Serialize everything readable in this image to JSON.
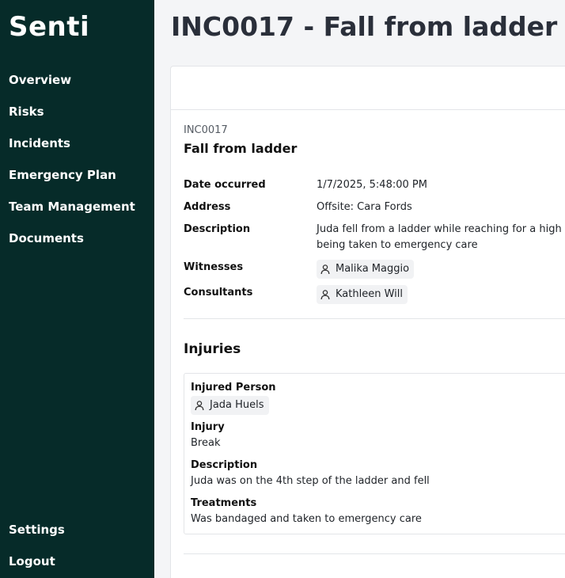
{
  "sidebar": {
    "logo": "Senti",
    "nav": [
      "Overview",
      "Risks",
      "Incidents",
      "Emergency Plan",
      "Team Management",
      "Documents"
    ],
    "bottom": [
      "Settings",
      "Logout"
    ]
  },
  "page": {
    "title": "INC0017 - Fall from ladder"
  },
  "incident": {
    "id": "INC0017",
    "title": "Fall from ladder",
    "fields": {
      "date_label": "Date occurred",
      "date_value": "1/7/2025, 5:48:00 PM",
      "address_label": "Address",
      "address_value": "Offsite: Cara Fords",
      "description_label": "Description",
      "description_value": "Juda fell from a ladder while reaching for a high sh being taken to emergency care",
      "witnesses_label": "Witnesses",
      "witness": "Malika Maggio",
      "consultants_label": "Consultants",
      "consultant": "Kathleen Will"
    }
  },
  "injuries": {
    "heading": "Injuries",
    "injured_person_label": "Injured Person",
    "injured_person": "Jada Huels",
    "injury_label": "Injury",
    "injury_value": "Break",
    "description_label": "Description",
    "description_value": "Juda was on the 4th step of the ladder and fell",
    "treatments_label": "Treatments",
    "treatments_value": "Was bandaged and taken to emergency care"
  },
  "icons": {
    "person": "person-icon"
  },
  "colors": {
    "sidebar_bg": "#062b29",
    "page_bg": "#f4f5f7",
    "chip_bg": "#f1f2f4"
  }
}
